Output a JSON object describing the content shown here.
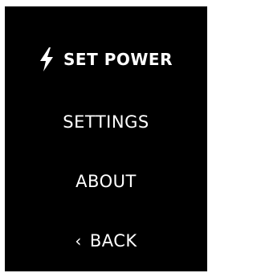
{
  "menu": {
    "items": [
      {
        "label": "SET POWER",
        "icon": "lightning-bolt-icon",
        "selected": true
      },
      {
        "label": "SETTINGS"
      },
      {
        "label": "ABOUT"
      },
      {
        "label": "BACK",
        "icon_glyph": "‹",
        "icon": "chevron-left-icon"
      }
    ]
  },
  "colors": {
    "background": "#000000",
    "text": "#ffffff"
  }
}
